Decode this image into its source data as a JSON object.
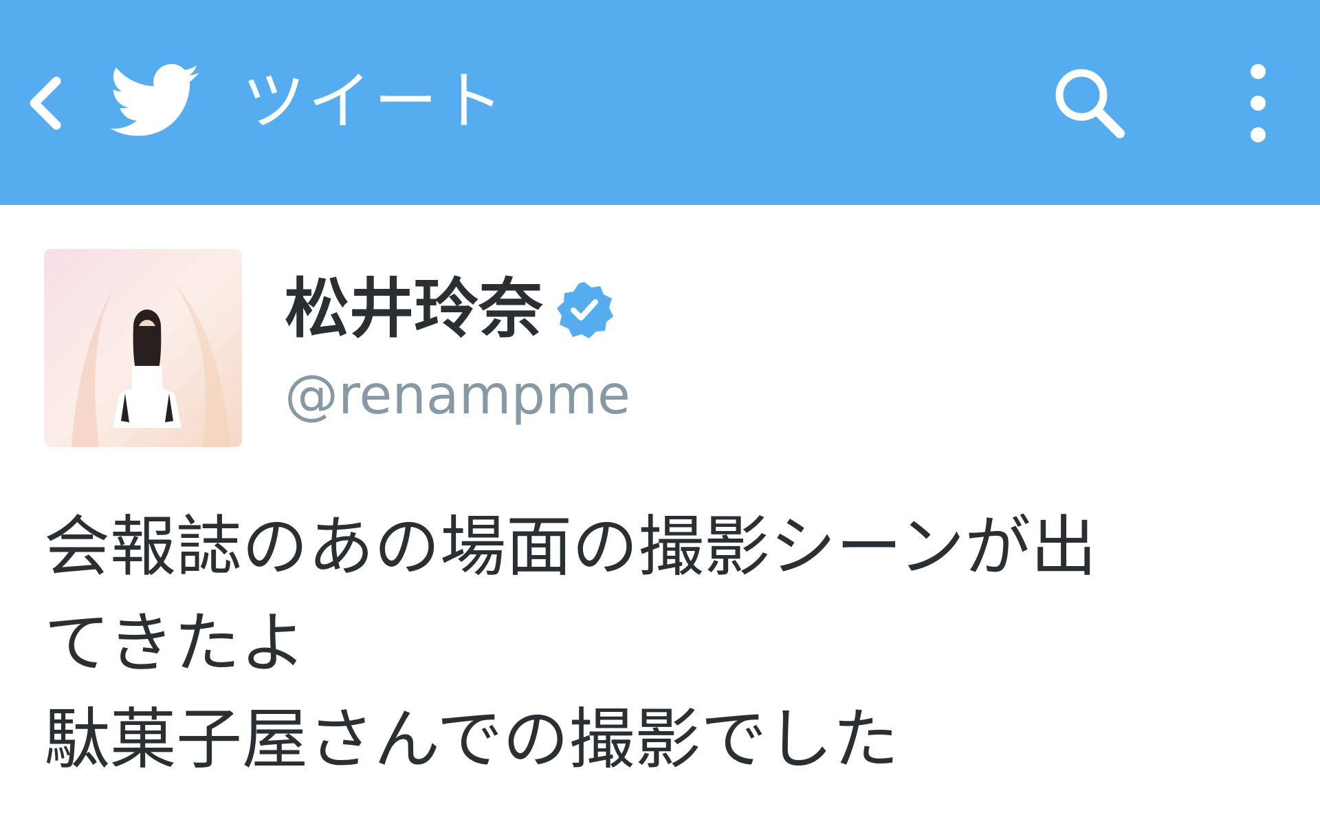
{
  "app_bar": {
    "title": "ツイート",
    "back_icon": "chevron-left-icon",
    "logo_icon": "twitter-bird-icon",
    "search_icon": "search-icon",
    "more_icon": "more-vertical-icon",
    "background_color": "#55acee"
  },
  "tweet": {
    "author": {
      "display_name": "松井玲奈",
      "handle": "@renampme",
      "verified": true,
      "verified_color": "#55acee"
    },
    "text": "会報誌のあの場面の撮影シーンが出\nてきたよ\n駄菓子屋さんでの撮影でした"
  }
}
